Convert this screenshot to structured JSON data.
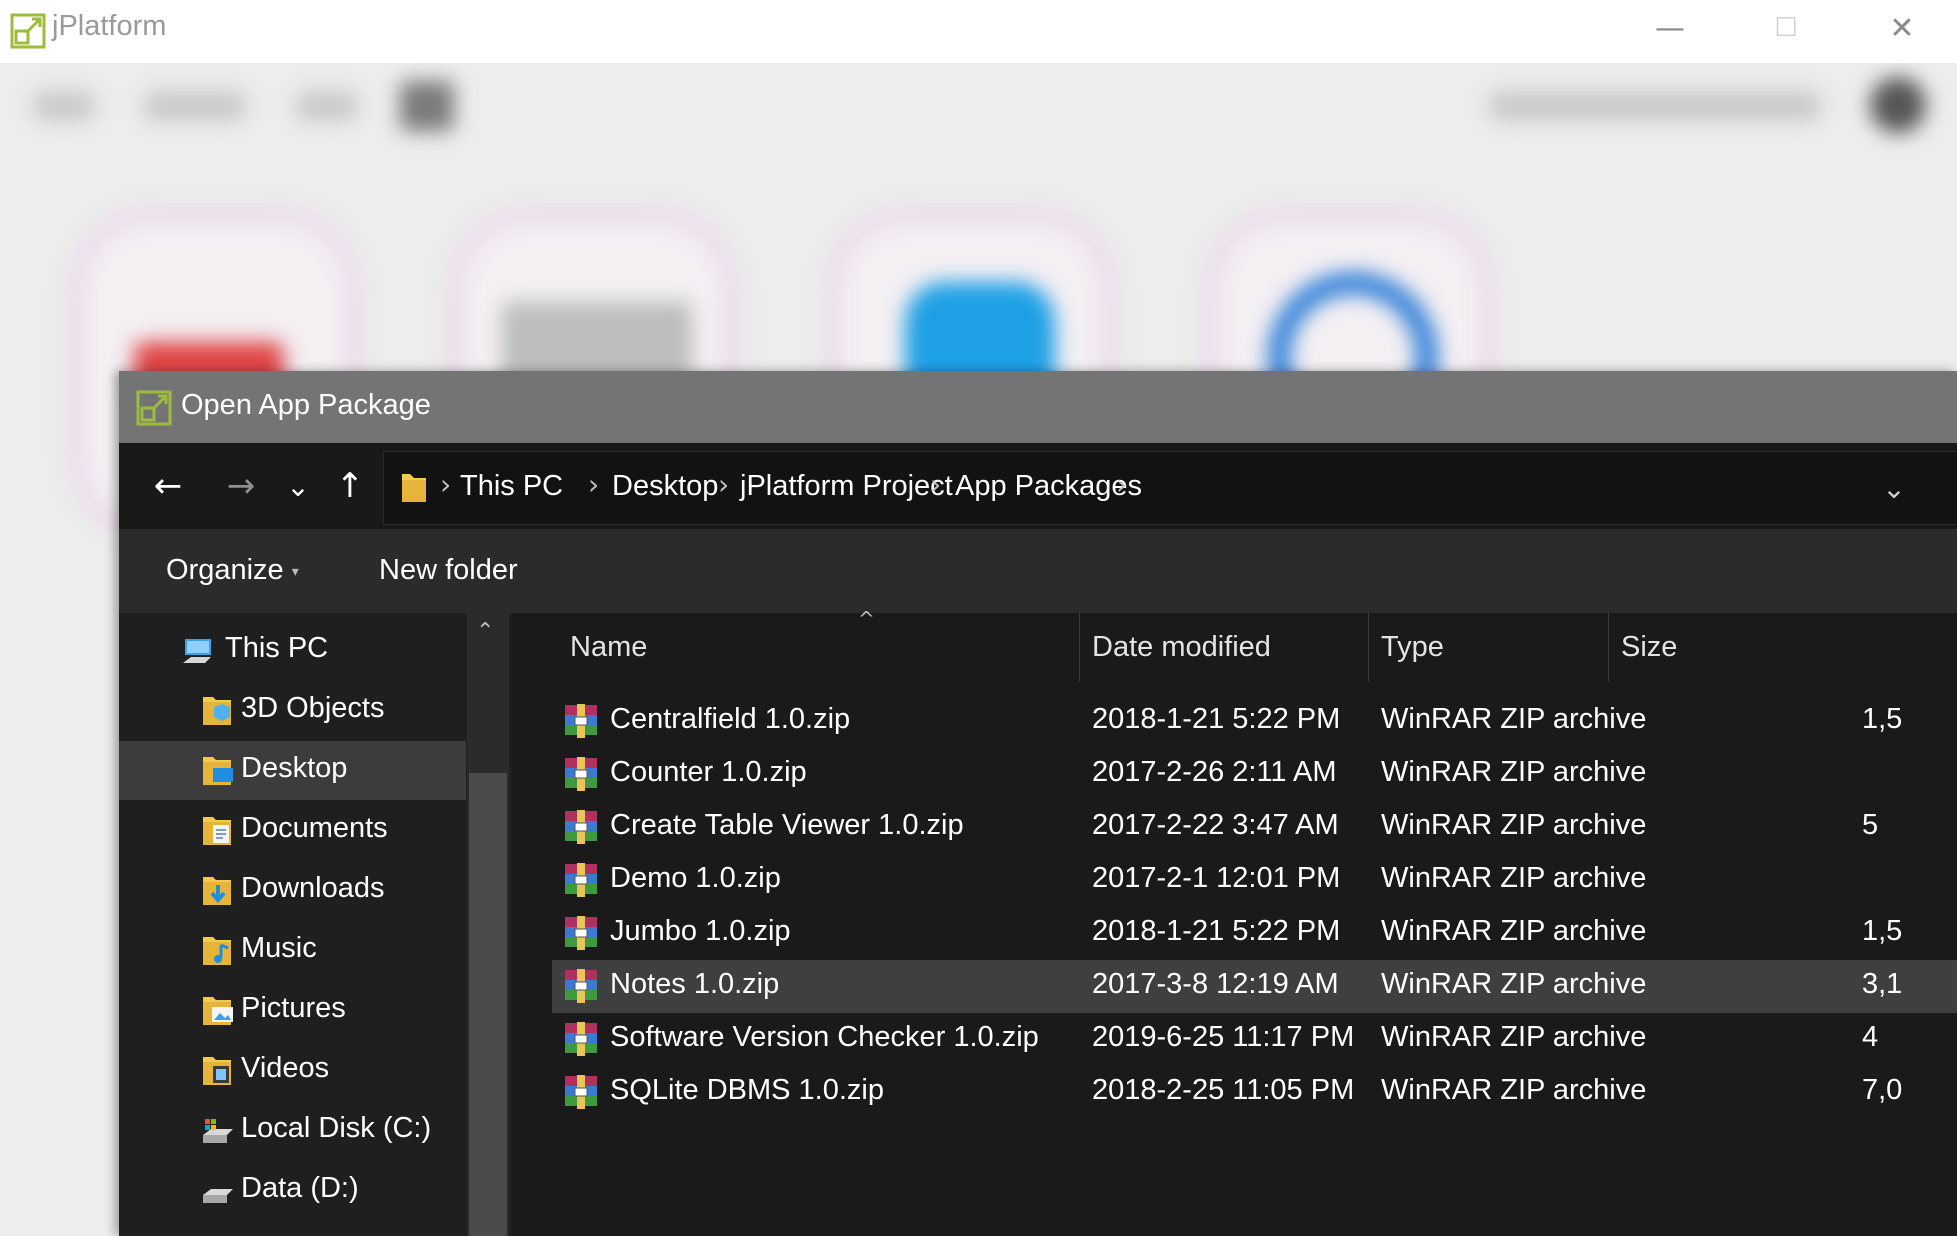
{
  "app": {
    "title": "jPlatform",
    "minimize": "—",
    "maximize": "☐",
    "close": "✕"
  },
  "dialog": {
    "title": "Open App Package",
    "nav": {
      "back": "←",
      "forward": "→",
      "recent": "⌄",
      "up": "↑"
    },
    "breadcrumb": [
      "This PC",
      "Desktop",
      "jPlatform Project",
      "App Packages"
    ],
    "breadcrumb_sep": "›",
    "addr_dropdown": "⌄",
    "toolbar": {
      "organize": "Organize",
      "organize_caret": "▾",
      "new_folder": "New folder"
    },
    "nav_pane": {
      "scroll_up": "⌃",
      "items": [
        {
          "label": "This PC",
          "icon": "computer-icon"
        },
        {
          "label": "3D Objects",
          "icon": "folder-3d-icon"
        },
        {
          "label": "Desktop",
          "icon": "folder-desktop-icon",
          "selected": true
        },
        {
          "label": "Documents",
          "icon": "folder-documents-icon"
        },
        {
          "label": "Downloads",
          "icon": "folder-downloads-icon"
        },
        {
          "label": "Music",
          "icon": "folder-music-icon"
        },
        {
          "label": "Pictures",
          "icon": "folder-pictures-icon"
        },
        {
          "label": "Videos",
          "icon": "folder-videos-icon"
        },
        {
          "label": "Local Disk (C:)",
          "icon": "drive-c-icon"
        },
        {
          "label": "Data (D:)",
          "icon": "drive-d-icon"
        }
      ]
    },
    "columns": {
      "name": "Name",
      "date": "Date modified",
      "type": "Type",
      "size": "Size",
      "sort_indicator": "^"
    },
    "files": [
      {
        "name": "Centralfield 1.0.zip",
        "date": "2018-1-21 5:22 PM",
        "type": "WinRAR ZIP archive",
        "size": "1,5"
      },
      {
        "name": "Counter 1.0.zip",
        "date": "2017-2-26 2:11 AM",
        "type": "WinRAR ZIP archive",
        "size": ""
      },
      {
        "name": "Create Table Viewer 1.0.zip",
        "date": "2017-2-22 3:47 AM",
        "type": "WinRAR ZIP archive",
        "size": "5"
      },
      {
        "name": "Demo 1.0.zip",
        "date": "2017-2-1 12:01 PM",
        "type": "WinRAR ZIP archive",
        "size": ""
      },
      {
        "name": "Jumbo 1.0.zip",
        "date": "2018-1-21 5:22 PM",
        "type": "WinRAR ZIP archive",
        "size": "1,5"
      },
      {
        "name": "Notes 1.0.zip",
        "date": "2017-3-8 12:19 AM",
        "type": "WinRAR ZIP archive",
        "size": "3,1",
        "selected": true
      },
      {
        "name": "Software Version Checker 1.0.zip",
        "date": "2019-6-25 11:17 PM",
        "type": "WinRAR ZIP archive",
        "size": "4"
      },
      {
        "name": "SQLite DBMS 1.0.zip",
        "date": "2018-2-25 11:05 PM",
        "type": "WinRAR ZIP archive",
        "size": "7,0"
      }
    ]
  }
}
